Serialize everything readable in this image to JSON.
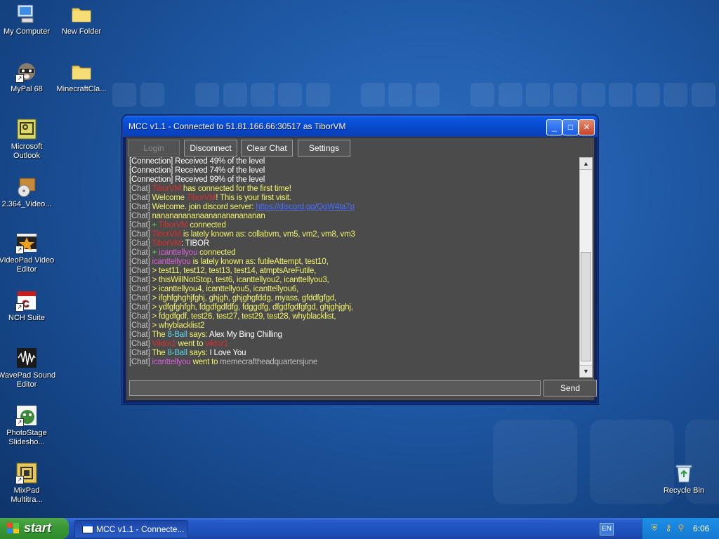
{
  "desktop": {
    "icons": [
      {
        "label": "My Computer",
        "icon": "computer-icon"
      },
      {
        "label": "New Folder",
        "icon": "folder-icon"
      },
      {
        "label": "MyPal 68",
        "icon": "raccoon-icon"
      },
      {
        "label": "MinecraftCla...",
        "icon": "folder-icon"
      },
      {
        "label": "Microsoft Outlook",
        "icon": "outlook-icon"
      },
      {
        "label": "2.364_Video...",
        "icon": "installer-icon"
      },
      {
        "label": "VideoPad Video Editor",
        "icon": "videopad-icon"
      },
      {
        "label": "NCH Suite",
        "icon": "nch-icon"
      },
      {
        "label": "WavePad Sound Editor",
        "icon": "wavepad-icon"
      },
      {
        "label": "PhotoStage Slidesho...",
        "icon": "photostage-icon"
      },
      {
        "label": "MixPad Multitra...",
        "icon": "mixpad-icon"
      },
      {
        "label": "Recycle Bin",
        "icon": "recycle-bin-icon"
      }
    ]
  },
  "window": {
    "title": "MCC v1.1 - Connected to 51.81.166.66:30517 as TiborVM",
    "toolbar": {
      "login": "Login",
      "disconnect": "Disconnect",
      "clear_chat": "Clear Chat",
      "settings": "Settings"
    },
    "chat": [
      [
        {
          "t": "[Connection] Received 49% of the level",
          "c": "w"
        }
      ],
      [
        {
          "t": "[Connection] Received 74% of the level",
          "c": "w"
        }
      ],
      [
        {
          "t": "[Connection] Received 99% of the level",
          "c": "w"
        }
      ],
      [
        {
          "t": "[Chat] ",
          "c": "g"
        },
        {
          "t": "TiborVM",
          "c": "r"
        },
        {
          "t": " has connected for the first time!",
          "c": "y"
        }
      ],
      [
        {
          "t": "[Chat] ",
          "c": "g"
        },
        {
          "t": "Welcome ",
          "c": "y"
        },
        {
          "t": "TiborVM",
          "c": "r"
        },
        {
          "t": "! This is your first visit.",
          "c": "y"
        }
      ],
      [
        {
          "t": "[Chat] ",
          "c": "g"
        },
        {
          "t": "Welcome. join discord server: ",
          "c": "y"
        },
        {
          "t": "https://discord.gg/QqW4ta7p",
          "c": "link"
        }
      ],
      [
        {
          "t": "[Chat] ",
          "c": "g"
        },
        {
          "t": "nanananananaananananananan",
          "c": "y"
        }
      ],
      [
        {
          "t": "[Chat] ",
          "c": "g"
        },
        {
          "t": "+ ",
          "c": "lg"
        },
        {
          "t": "TiborVM",
          "c": "r"
        },
        {
          "t": " connected",
          "c": "y"
        }
      ],
      [
        {
          "t": "[Chat] ",
          "c": "g"
        },
        {
          "t": "TiborVM",
          "c": "r"
        },
        {
          "t": " is lately known as: collabvm, vm5, vm2, vm8, vm3",
          "c": "y"
        }
      ],
      [
        {
          "t": "[Chat] ",
          "c": "g"
        },
        {
          "t": "TiborVM",
          "c": "r"
        },
        {
          "t": ": TIBOR",
          "c": "w"
        }
      ],
      [
        {
          "t": "[Chat] ",
          "c": "g"
        },
        {
          "t": "+ ",
          "c": "lg"
        },
        {
          "t": "icanttellyou",
          "c": "m"
        },
        {
          "t": " connected",
          "c": "y"
        }
      ],
      [
        {
          "t": "[Chat] ",
          "c": "g"
        },
        {
          "t": "icanttellyou",
          "c": "m"
        },
        {
          "t": " is lately known as: futileAttempt, test10,",
          "c": "y"
        }
      ],
      [
        {
          "t": "[Chat] ",
          "c": "g"
        },
        {
          "t": "> test11, test12, test13, test14, atmptsAreFutile,",
          "c": "y"
        }
      ],
      [
        {
          "t": "[Chat] ",
          "c": "g"
        },
        {
          "t": "> thisWillNotStop, test6, icanttellyou2, icanttellyou3,",
          "c": "y"
        }
      ],
      [
        {
          "t": "[Chat] ",
          "c": "g"
        },
        {
          "t": "> icanttellyou4, icanttellyou5, icanttellyou6,",
          "c": "y"
        }
      ],
      [
        {
          "t": "[Chat] ",
          "c": "g"
        },
        {
          "t": "> ifghfghghjfghj, ghjgh, ghjghgfddg, myass, gfddfgfgd,",
          "c": "y"
        }
      ],
      [
        {
          "t": "[Chat] ",
          "c": "g"
        },
        {
          "t": "> ydfgfghfgh, fdgdfgdfdfg, fdggdfg, dfgdfgdfgfgd, ghjghjghj,",
          "c": "y"
        }
      ],
      [
        {
          "t": "[Chat] ",
          "c": "g"
        },
        {
          "t": "> fdgdfgdf, test26, test27, test29, test28, whyblacklist,",
          "c": "y"
        }
      ],
      [
        {
          "t": "[Chat] ",
          "c": "g"
        },
        {
          "t": "> whyblacklist2",
          "c": "y"
        }
      ],
      [
        {
          "t": "[Chat] ",
          "c": "g"
        },
        {
          "t": "The ",
          "c": "y"
        },
        {
          "t": "8-Ball",
          "c": "c"
        },
        {
          "t": " says: ",
          "c": "y"
        },
        {
          "t": "Alex My Bing Chilling",
          "c": "w"
        }
      ],
      [
        {
          "t": "[Chat] ",
          "c": "g"
        },
        {
          "t": "Viktor1",
          "c": "r"
        },
        {
          "t": " went to ",
          "c": "y"
        },
        {
          "t": "viktor1",
          "c": "r"
        }
      ],
      [
        {
          "t": "[Chat] ",
          "c": "g"
        },
        {
          "t": "The ",
          "c": "y"
        },
        {
          "t": "8-Ball",
          "c": "c"
        },
        {
          "t": " says: ",
          "c": "y"
        },
        {
          "t": "I Love You",
          "c": "w"
        }
      ],
      [
        {
          "t": "[Chat] ",
          "c": "g"
        },
        {
          "t": "icanttellyou",
          "c": "m"
        },
        {
          "t": " went to ",
          "c": "y"
        },
        {
          "t": "memecraftheadquartersjune",
          "c": "gy"
        }
      ]
    ],
    "input_value": "",
    "send": "Send"
  },
  "taskbar": {
    "start": "start",
    "task_label": "MCC v1.1 - Connecte...",
    "lang": "EN",
    "clock": "6:06"
  }
}
